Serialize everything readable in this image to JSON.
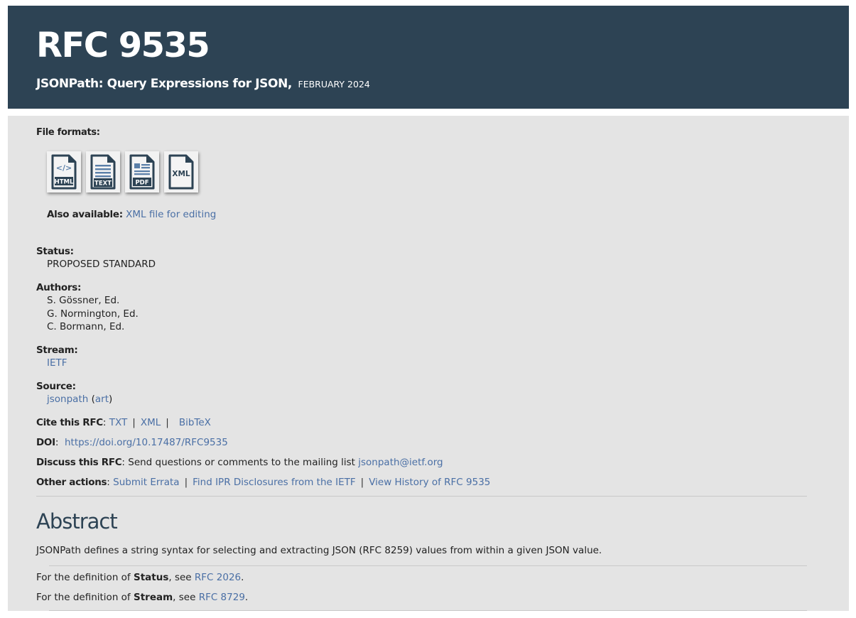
{
  "header": {
    "title": "RFC 9535",
    "subtitle": "JSONPath: Query Expressions for JSON,",
    "date": "FEBRUARY 2024"
  },
  "file_formats": {
    "label": "File formats:",
    "icons": [
      {
        "name": "html-file-icon",
        "text": "HTML"
      },
      {
        "name": "text-file-icon",
        "text": "TEXT"
      },
      {
        "name": "pdf-file-icon",
        "text": "PDF"
      },
      {
        "name": "xml-file-icon",
        "text": "XML"
      }
    ],
    "also_label": "Also available:",
    "also_link": "XML file for editing"
  },
  "status": {
    "label": "Status:",
    "value": "PROPOSED STANDARD"
  },
  "authors": {
    "label": "Authors:",
    "list": [
      "S. Gössner, Ed.",
      "G. Normington, Ed.",
      "C. Bormann, Ed."
    ]
  },
  "stream": {
    "label": "Stream:",
    "value": "IETF"
  },
  "source": {
    "label": "Source:",
    "value": "jsonpath",
    "open_paren": "(",
    "art": "art",
    "close_paren": ")"
  },
  "cite": {
    "label": "Cite this RFC",
    "colon": ":",
    "links": [
      "TXT",
      "XML",
      "BibTeX"
    ],
    "separator": "|"
  },
  "doi": {
    "label": "DOI",
    "colon": ":",
    "value": "https://doi.org/10.17487/RFC9535"
  },
  "discuss": {
    "label": "Discuss this RFC",
    "text": ": Send questions or comments to the mailing list",
    "email": "jsonpath@ietf.org"
  },
  "other_actions": {
    "label": "Other actions",
    "colon": ":",
    "links": [
      "Submit Errata",
      "Find IPR Disclosures from the IETF",
      "View History of RFC 9535"
    ],
    "separator": "|"
  },
  "abstract": {
    "heading": "Abstract",
    "text": "JSONPath defines a string syntax for selecting and extracting JSON (RFC 8259) values from within a given JSON value."
  },
  "definitions": [
    {
      "prefix": "For the definition of",
      "term": "Status",
      "mid": ", see",
      "link": "RFC 2026",
      "suffix": "."
    },
    {
      "prefix": "For the definition of",
      "term": "Stream",
      "mid": ", see",
      "link": "RFC 8729",
      "suffix": "."
    }
  ],
  "colors": {
    "header_bg": "#2d4354",
    "panel_bg": "#e4e4e4",
    "link": "#4a6fa5",
    "icon": "#2d4354"
  }
}
